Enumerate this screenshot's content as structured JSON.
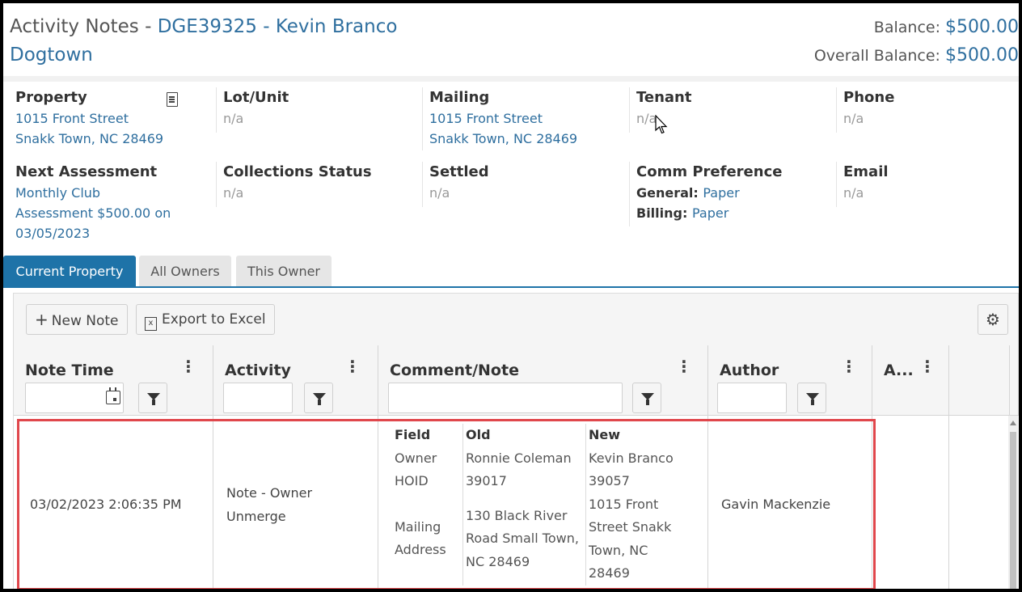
{
  "header": {
    "title_prefix": "Activity Notes - ",
    "title_link": "DGE39325 - Kevin Branco",
    "subtitle": "Dogtown",
    "balance_label": "Balance: ",
    "balance_value": "$500.00",
    "overall_label": "Overall Balance: ",
    "overall_value": "$500.00"
  },
  "info": {
    "property": {
      "label": "Property",
      "line1": "1015 Front Street",
      "line2": "Snakk Town, NC 28469"
    },
    "lot_unit": {
      "label": "Lot/Unit",
      "value": "n/a"
    },
    "mailing": {
      "label": "Mailing",
      "line1": "1015 Front Street",
      "line2": "Snakk Town, NC 28469"
    },
    "tenant": {
      "label": "Tenant",
      "value": "n/a"
    },
    "phone": {
      "label": "Phone",
      "value": "n/a"
    },
    "next_assessment": {
      "label": "Next Assessment",
      "line1": "Monthly Club",
      "line2": "Assessment $500.00 on",
      "line3": "03/05/2023"
    },
    "collections_status": {
      "label": "Collections Status",
      "value": "n/a"
    },
    "settled": {
      "label": "Settled",
      "value": "n/a"
    },
    "comm_preference": {
      "label": "Comm Preference",
      "general_label": "General: ",
      "general_value": "Paper",
      "billing_label": "Billing: ",
      "billing_value": "Paper"
    },
    "email": {
      "label": "Email",
      "value": "n/a"
    }
  },
  "tabs": [
    {
      "label": "Current Property",
      "active": true
    },
    {
      "label": "All Owners",
      "active": false
    },
    {
      "label": "This Owner",
      "active": false
    }
  ],
  "toolbar": {
    "new_note": "New Note",
    "export": "Export to Excel",
    "excel_glyph": "x"
  },
  "columns": {
    "note_time": "Note Time",
    "activity": "Activity",
    "comment": "Comment/Note",
    "author": "Author",
    "a": "A..."
  },
  "row": {
    "note_time": "03/02/2023 2:06:35 PM",
    "activity_line1": "Note - Owner",
    "activity_line2": "Unmerge",
    "author": "Gavin Mackenzie",
    "changes": {
      "headers": [
        "Field",
        "Old",
        "New"
      ],
      "field": [
        "Owner",
        "HOID",
        "Mailing",
        "Address"
      ],
      "old": [
        "Ronnie Coleman",
        "39017",
        "130 Black River",
        "Road Small Town,",
        "NC 28469"
      ],
      "new": [
        "Kevin Branco",
        "39057",
        "1015 Front",
        "Street Snakk",
        "Town, NC",
        "28469"
      ]
    }
  },
  "icons": {
    "kebab": "⋮",
    "gear": "⚙",
    "plus": "+"
  },
  "colors": {
    "link": "#2f6f9f",
    "tab_active": "#1e73a8",
    "highlight": "#e0474c"
  }
}
